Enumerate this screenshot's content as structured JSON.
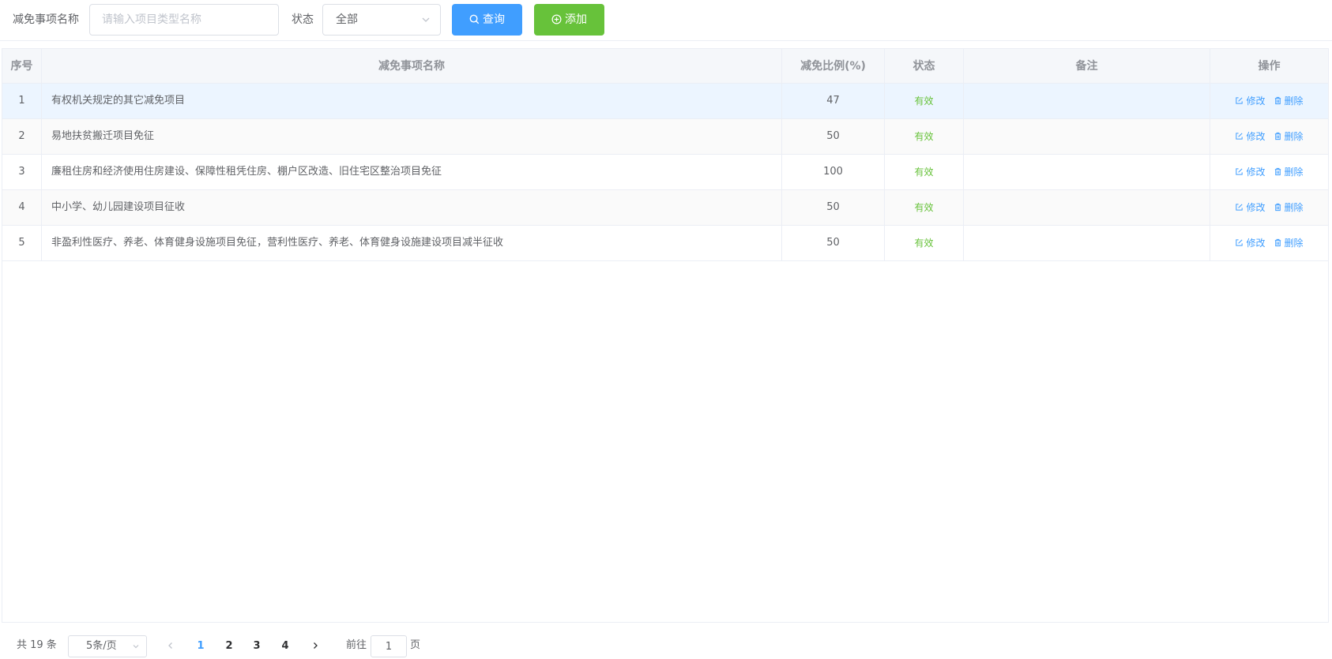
{
  "filters": {
    "name_label": "减免事项名称",
    "name_placeholder": "请输入项目类型名称",
    "name_value": "",
    "status_label": "状态",
    "status_value": "全部",
    "search_label": "查询",
    "add_label": "添加"
  },
  "table": {
    "columns": [
      "序号",
      "减免事项名称",
      "减免比例(%)",
      "状态",
      "备注",
      "操作"
    ],
    "rows": [
      {
        "index": "1",
        "name": "有权机关规定的其它减免项目",
        "ratio": "47",
        "status": "有效",
        "note": ""
      },
      {
        "index": "2",
        "name": "易地扶贫搬迁项目免征",
        "ratio": "50",
        "status": "有效",
        "note": ""
      },
      {
        "index": "3",
        "name": "廉租住房和经济使用住房建设、保障性租凭住房、棚户区改造、旧住宅区整治项目免征",
        "ratio": "100",
        "status": "有效",
        "note": ""
      },
      {
        "index": "4",
        "name": "中小学、幼儿园建设项目征收",
        "ratio": "50",
        "status": "有效",
        "note": ""
      },
      {
        "index": "5",
        "name": "非盈利性医疗、养老、体育健身设施项目免征，营利性医疗、养老、体育健身设施建设项目减半征收",
        "ratio": "50",
        "status": "有效",
        "note": ""
      }
    ],
    "edit_label": "修改",
    "delete_label": "删除"
  },
  "pagination": {
    "total_text": "共 19 条",
    "page_size_text": "5条/页",
    "pages": [
      "1",
      "2",
      "3",
      "4"
    ],
    "current_page": "1",
    "goto_label": "前往",
    "goto_value": "1",
    "page_suffix": "页"
  },
  "colors": {
    "primary": "#409eff",
    "success": "#67c23a",
    "border": "#ebeef5",
    "header_bg": "#f5f7fa",
    "highlight_row": "#ecf5ff"
  }
}
